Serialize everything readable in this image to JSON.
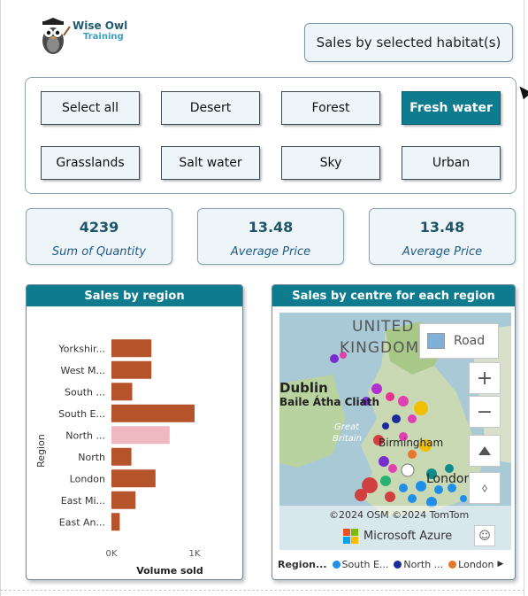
{
  "logo": {
    "line1": "Wise Owl",
    "line2": "Training"
  },
  "title_button": {
    "label": "Sales by selected habitat(s)"
  },
  "habitat_slicer": {
    "buttons": [
      {
        "label": "Select all",
        "selected": false
      },
      {
        "label": "Desert",
        "selected": false
      },
      {
        "label": "Forest",
        "selected": false
      },
      {
        "label": "Fresh water",
        "selected": true
      },
      {
        "label": "Grasslands",
        "selected": false
      },
      {
        "label": "Salt water",
        "selected": false
      },
      {
        "label": "Sky",
        "selected": false
      },
      {
        "label": "Urban",
        "selected": false
      }
    ]
  },
  "kpi_cards": [
    {
      "value": "4239",
      "label": "Sum of Quantity"
    },
    {
      "value": "13.48",
      "label": "Average Price"
    },
    {
      "value": "13.48",
      "label": "Average Price"
    }
  ],
  "region_panel": {
    "title": "Sales by region",
    "y_axis_label": "Region",
    "x_axis_label": "Volume sold",
    "x_ticks": [
      "0K",
      "1K"
    ]
  },
  "map_panel": {
    "title": "Sales by centre for each region",
    "road_label": "Road",
    "zoom_in": "+",
    "zoom_out": "−",
    "copyright": "©2024 OSM  ©2024 TomTom",
    "brand": "Microsoft Azure",
    "place_labels": [
      "UNITED",
      "KINGDOM",
      "Dublin",
      "Baile Átha Cliath",
      "Great",
      "Britain",
      "Birmingham",
      "London",
      "Am"
    ],
    "legend_title": "Region...",
    "legend": [
      {
        "label": "South E...",
        "color": "#1f8fe8"
      },
      {
        "label": "North ...",
        "color": "#1a2a9a"
      },
      {
        "label": "London",
        "color": "#e8772e"
      }
    ]
  },
  "chart_data": {
    "type": "bar",
    "orientation": "horizontal",
    "categories": [
      "Yorkshir...",
      "West M...",
      "South ...",
      "South E...",
      "North ...",
      "North",
      "London",
      "East Mi...",
      "East An..."
    ],
    "values": [
      480,
      480,
      250,
      1000,
      700,
      240,
      530,
      290,
      100
    ],
    "highlighted": "North ...",
    "colors": {
      "bar": "#b5532a",
      "highlight": "#f0b8c0"
    },
    "xlabel": "Volume sold",
    "ylabel": "Region",
    "xlim": [
      0,
      1000
    ],
    "xticks": [
      "0K",
      "1K"
    ]
  }
}
